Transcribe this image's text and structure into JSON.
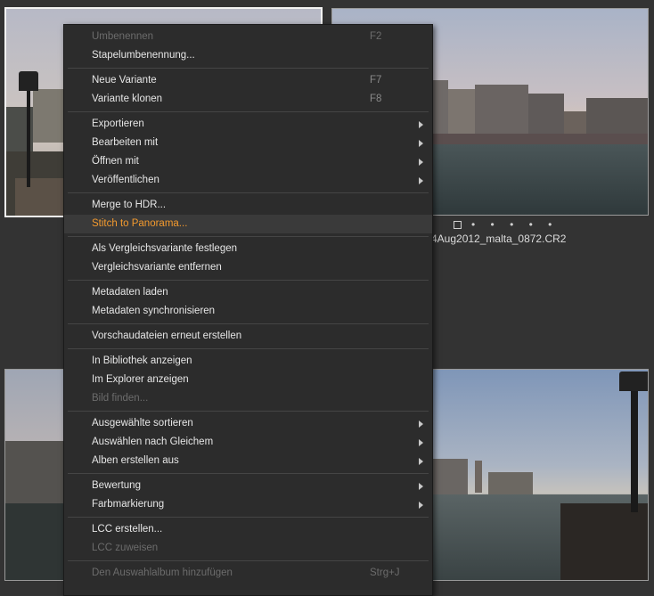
{
  "thumbnails": {
    "top_right_caption": "4Aug2012_malta_0872.CR2",
    "rating_dots": "• • • • •"
  },
  "menu": {
    "groups": [
      [
        {
          "label": "Umbenennen",
          "shortcut": "F2",
          "disabled": true
        },
        {
          "label": "Stapelumbenennung..."
        }
      ],
      [
        {
          "label": "Neue Variante",
          "shortcut": "F7"
        },
        {
          "label": "Variante klonen",
          "shortcut": "F8"
        }
      ],
      [
        {
          "label": "Exportieren",
          "submenu": true
        },
        {
          "label": "Bearbeiten mit",
          "submenu": true
        },
        {
          "label": "Öffnen mit",
          "submenu": true
        },
        {
          "label": "Veröffentlichen",
          "submenu": true
        }
      ],
      [
        {
          "label": "Merge to HDR..."
        },
        {
          "label": "Stitch to Panorama...",
          "highlighted": true
        }
      ],
      [
        {
          "label": "Als Vergleichsvariante festlegen"
        },
        {
          "label": "Vergleichsvariante entfernen"
        }
      ],
      [
        {
          "label": "Metadaten laden"
        },
        {
          "label": "Metadaten synchronisieren"
        }
      ],
      [
        {
          "label": "Vorschaudateien erneut erstellen"
        }
      ],
      [
        {
          "label": "In Bibliothek anzeigen"
        },
        {
          "label": "Im Explorer anzeigen"
        },
        {
          "label": "Bild finden...",
          "disabled": true
        }
      ],
      [
        {
          "label": "Ausgewählte sortieren",
          "submenu": true
        },
        {
          "label": "Auswählen nach Gleichem",
          "submenu": true
        },
        {
          "label": "Alben erstellen aus",
          "submenu": true
        }
      ],
      [
        {
          "label": "Bewertung",
          "submenu": true
        },
        {
          "label": "Farbmarkierung",
          "submenu": true
        }
      ],
      [
        {
          "label": "LCC erstellen..."
        },
        {
          "label": "LCC zuweisen",
          "disabled": true
        }
      ],
      [
        {
          "label": "Den Auswahlalbum hinzufügen",
          "shortcut": "Strg+J",
          "disabled": true
        }
      ]
    ]
  }
}
